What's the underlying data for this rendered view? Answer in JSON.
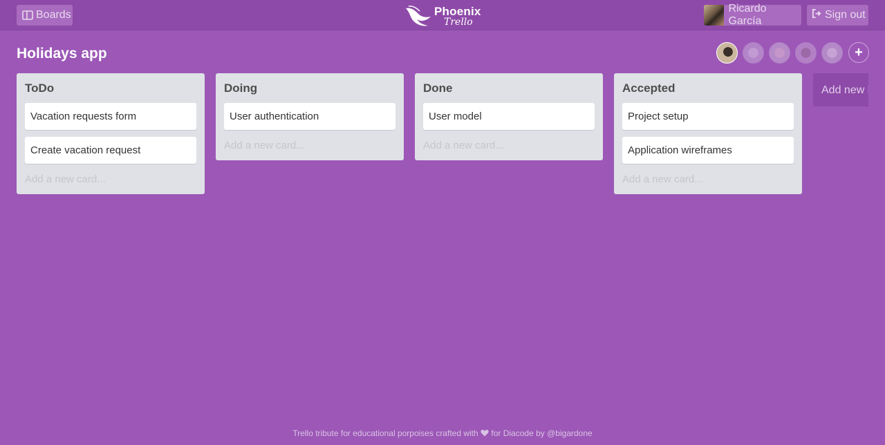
{
  "header": {
    "boards_label": "Boards",
    "logo_line1": "Phoenix",
    "logo_line2": "Trello",
    "user_name": "Ricardo García",
    "signout_label": "Sign out"
  },
  "board": {
    "title": "Holidays app",
    "add_list_label": "Add new list",
    "add_card_label": "Add a new card..."
  },
  "lists": [
    {
      "title": "ToDo",
      "cards": [
        "Vacation requests form",
        "Create vacation request"
      ]
    },
    {
      "title": "Doing",
      "cards": [
        "User authentication"
      ]
    },
    {
      "title": "Done",
      "cards": [
        "User model"
      ]
    },
    {
      "title": "Accepted",
      "cards": [
        "Project setup",
        "Application wireframes"
      ]
    }
  ],
  "footer": {
    "text_before": "Trello tribute for educational porpoises crafted with",
    "text_middle": "for",
    "link1": "Diacode",
    "text_by": "by",
    "link2": "@bigardone"
  },
  "colors": {
    "background": "#9c57b7",
    "header": "#8e4aa8",
    "list": "#dfe1e6"
  },
  "icons": [
    "boards-icon",
    "sign-out-icon",
    "phoenix-bird-icon",
    "heart-icon",
    "plus-icon"
  ]
}
